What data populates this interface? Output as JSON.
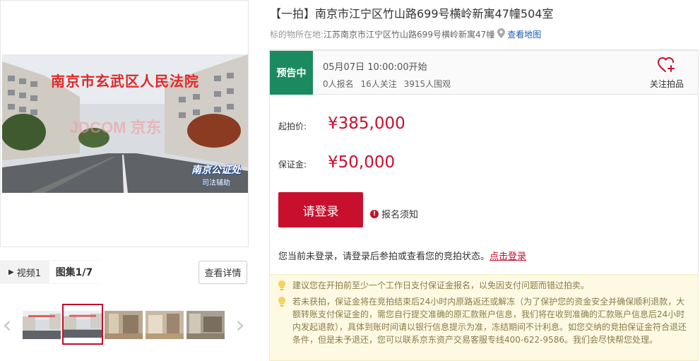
{
  "gallery": {
    "court_text": "南京市玄武区人民法院",
    "watermark": "JDCOM 京东",
    "notary_line1": "南京公证处",
    "notary_line2": "司法辅助",
    "tabs": [
      {
        "label": "视频1",
        "icon": "play-icon"
      },
      {
        "label": "图集1/7"
      }
    ],
    "detail_button": "查看详情",
    "thumbnail_count": 5,
    "active_thumbnail": 2
  },
  "listing": {
    "title": "【一拍】南京市江宁区竹山路699号横岭新寓47幢504室",
    "location_label": "标的物所在地:",
    "location_value": "江苏南京市江宁区竹山路699号横岭新寓47幢",
    "map_link": "查看地图"
  },
  "status": {
    "badge": "预告中",
    "badge_color": "#1c8a60",
    "start_time": "05月07日 10:00:00开始",
    "signups": "0人报名",
    "followers": "16人关注",
    "viewers": "3915人围观",
    "follow_label": "关注拍品"
  },
  "pricing": {
    "start_label": "起拍价:",
    "start_value": "¥385,000",
    "deposit_label": "保证金:",
    "deposit_value": "¥50,000",
    "accent_color": "#c8102e"
  },
  "actions": {
    "login_button": "请登录",
    "notice_label": "报名须知",
    "login_prompt": "您当前未登录，请登录后参拍或查看您的竞拍状态。",
    "login_link": "点击登录"
  },
  "tips": [
    "建议您在开拍前至少一个工作日支付保证金报名，以免因支付问题而错过拍卖。",
    "若未获拍，保证金将在竞拍结束后24小时内原路返还或解冻（为了保护您的资金安全并确保顺利退款，大额转账支付保证金的，需您自行提交准确的原汇款账户信息，我们将在收到准确的汇款账户信息后24小时内发起退款），具体到账时间请以银行信息提示为准，冻结期间不计利息。如您交纳的竞拍保证金符合退还条件，但是未予退还，您可以联系京东资产交易客服专线400-622-9586。我们会尽快帮您处理。"
  ]
}
